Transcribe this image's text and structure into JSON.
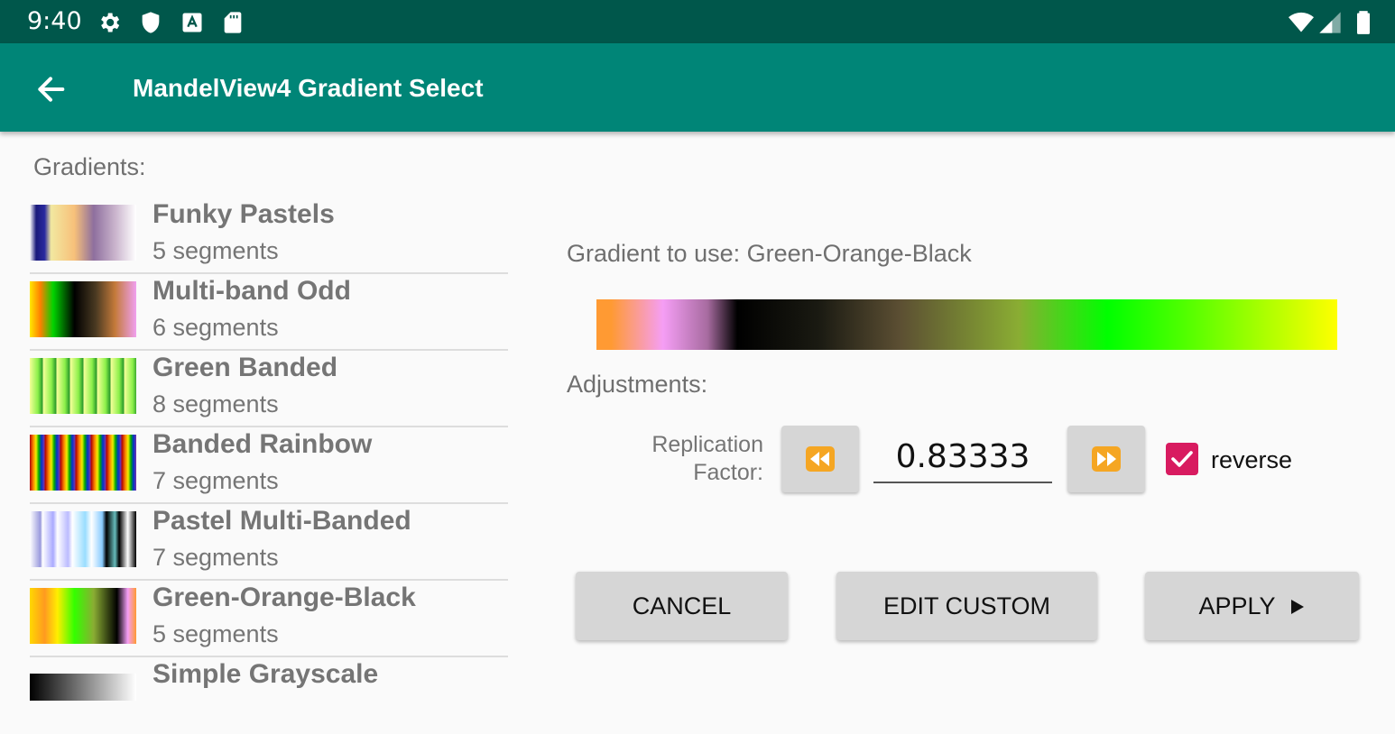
{
  "status_bar": {
    "time": "9:40",
    "icons": [
      "gear-icon",
      "shield-icon",
      "a-app-icon",
      "sd-card-icon",
      "wifi-icon",
      "cellular-signal-icon",
      "battery-icon"
    ],
    "background": "#00574b"
  },
  "app_bar": {
    "title": "MandelView4 Gradient Select",
    "back_icon": "arrow-back-icon",
    "background": "#008577"
  },
  "gradients_label": "Gradients:",
  "gradients": [
    {
      "name": "Funky Pastels",
      "segments": "5 segments",
      "colors": [
        "#1a1a7a",
        "#f2e8a0",
        "#f7c07a",
        "#8e6f9e",
        "#ffffff"
      ]
    },
    {
      "name": "Multi-band Odd",
      "segments": "6 segments",
      "colors": [
        "#ffe800",
        "#00d400",
        "#000000",
        "#c47a3a",
        "#f0a0f0"
      ]
    },
    {
      "name": "Green Banded",
      "segments": "8 segments",
      "colors": [
        "#e6ff66",
        "#66ee33",
        "#1a8a1a"
      ]
    },
    {
      "name": "Banded Rainbow",
      "segments": "7 segments",
      "colors": [
        "#a00000",
        "#ff8800",
        "#00aa00",
        "#0000cc",
        "#55ccff"
      ]
    },
    {
      "name": "Pastel Multi-Banded",
      "segments": "7 segments",
      "colors": [
        "#eeeeff",
        "#aaaaff",
        "#aaddff",
        "#000000",
        "#ffffff"
      ]
    },
    {
      "name": "Green-Orange-Black",
      "segments": "5 segments",
      "colors": [
        "#ffd800",
        "#ff9a20",
        "#33ff00",
        "#000000",
        "#ffffff"
      ]
    },
    {
      "name": "Simple Grayscale",
      "segments": "",
      "colors": [
        "#000000",
        "#ffffff"
      ]
    }
  ],
  "gradient_to_use": "Gradient to use: Green-Orange-Black",
  "preview_colors": [
    "#ff9a33",
    "#f59ef5",
    "#a76ba0",
    "#000000",
    "#3a3022",
    "#6a6035",
    "#8aad33",
    "#00ff00",
    "#55ff00",
    "#ffff00"
  ],
  "adjustments_label": "Adjustments:",
  "replication_label": "Replication Factor:",
  "replication_value": "0.83333",
  "decrease_icon": "rewind-icon",
  "increase_icon": "fast-forward-icon",
  "reverse_label": "reverse",
  "reverse_checked": true,
  "accent_color": "#d81b60",
  "buttons": {
    "cancel": "CANCEL",
    "edit_custom": "EDIT CUSTOM",
    "apply": "APPLY",
    "apply_icon": "play-icon"
  }
}
